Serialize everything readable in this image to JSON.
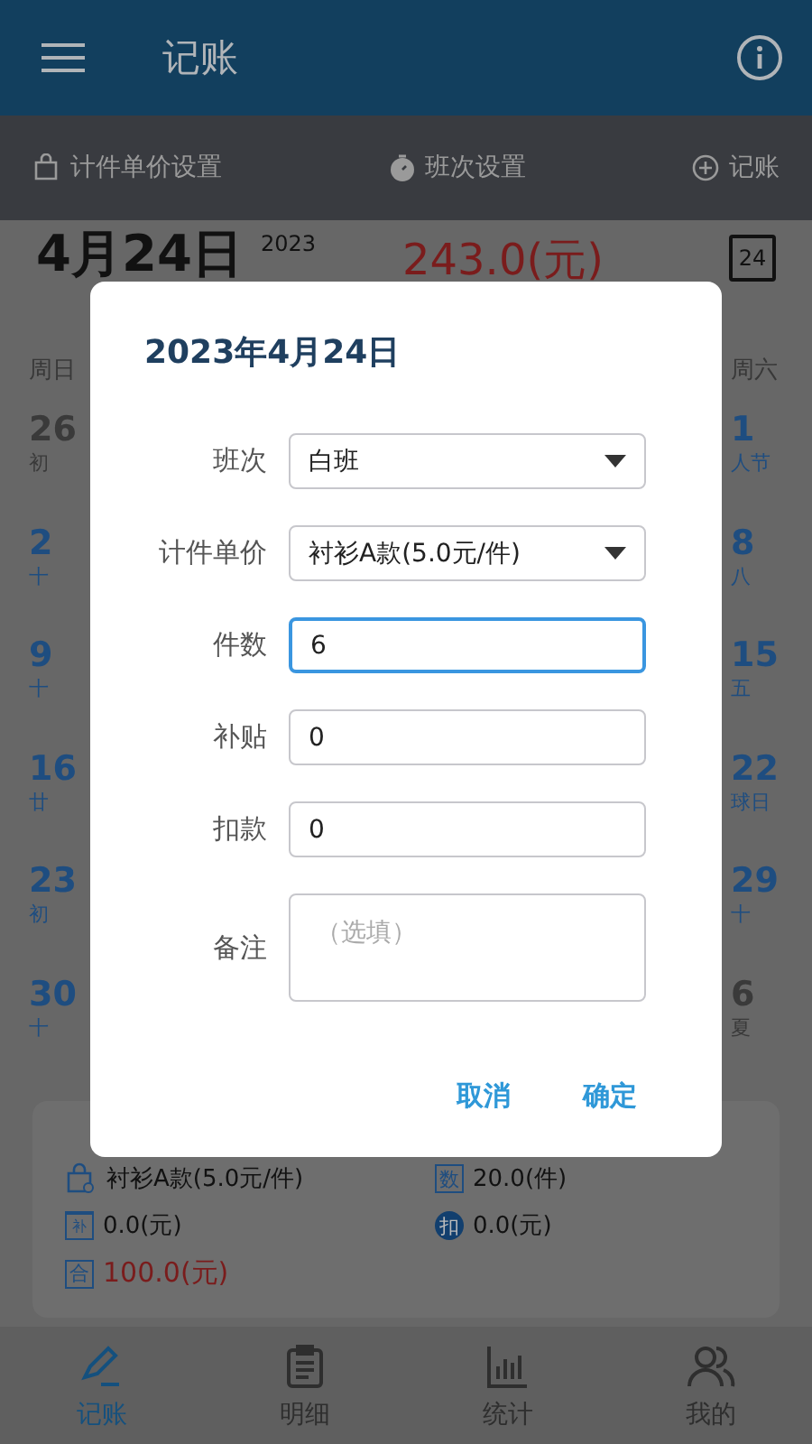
{
  "app_bar": {
    "title": "记账"
  },
  "toolbar": [
    {
      "kind": "bag",
      "label": "计件单价设置"
    },
    {
      "kind": "timer",
      "label": "班次设置"
    },
    {
      "kind": "plus",
      "label": "记账"
    }
  ],
  "date_header": {
    "date": "4月24日",
    "year": "2023",
    "total": "243.0(元)",
    "calendar_day": "24"
  },
  "calendar": {
    "columns": [
      {
        "weekday": "周日",
        "days": [
          {
            "day": "26",
            "lunar": "初",
            "in_month": false
          },
          {
            "day": "2",
            "lunar": "十",
            "in_month": true
          },
          {
            "day": "9",
            "lunar": "十",
            "in_month": true
          },
          {
            "day": "16",
            "lunar": "廿",
            "in_month": true
          },
          {
            "day": "23",
            "lunar": "初",
            "in_month": true
          },
          {
            "day": "30",
            "lunar": "十",
            "in_month": true
          }
        ]
      },
      {
        "weekday": "周六",
        "days": [
          {
            "day": "1",
            "lunar": "人节",
            "in_month": true
          },
          {
            "day": "8",
            "lunar": "八",
            "in_month": true
          },
          {
            "day": "15",
            "lunar": "五",
            "in_month": true
          },
          {
            "day": "22",
            "lunar": "球日",
            "in_month": true
          },
          {
            "day": "29",
            "lunar": "十",
            "in_month": true
          },
          {
            "day": "6",
            "lunar": "夏",
            "in_month": false
          }
        ]
      }
    ]
  },
  "day_summary": {
    "items": [
      {
        "kind": "bag",
        "text": "衬衫A款(5.0元/件)",
        "emphasis": false
      },
      {
        "kind": "square",
        "badge": "数",
        "text": "20.0(件)",
        "emphasis": false
      },
      {
        "kind": "calendar",
        "badge": "补",
        "text": "0.0(元)",
        "emphasis": false
      },
      {
        "kind": "circle",
        "badge": "扣",
        "text": "0.0(元)",
        "emphasis": false
      },
      {
        "kind": "square",
        "badge": "合",
        "text": "100.0(元)",
        "emphasis": true
      }
    ]
  },
  "tabs": [
    {
      "kind": "pencil",
      "label": "记账",
      "selected": true
    },
    {
      "kind": "clipboard",
      "label": "明细",
      "selected": false
    },
    {
      "kind": "chart",
      "label": "统计",
      "selected": false
    },
    {
      "kind": "people",
      "label": "我的",
      "selected": false
    }
  ],
  "dialog": {
    "title": "2023年4月24日",
    "fields": [
      {
        "kind": "select",
        "label": "班次",
        "value": "白班",
        "focused": false
      },
      {
        "kind": "select",
        "label": "计件单价",
        "value": "衬衫A款(5.0元/件)",
        "focused": false
      },
      {
        "kind": "input",
        "label": "件数",
        "value": "6",
        "focused": true
      },
      {
        "kind": "input",
        "label": "补贴",
        "value": "0",
        "focused": false
      },
      {
        "kind": "input",
        "label": "扣款",
        "value": "0",
        "focused": false
      },
      {
        "kind": "textarea",
        "label": "备注",
        "placeholder": "（选填）",
        "focused": false
      }
    ],
    "buttons": [
      "取消",
      "确定"
    ]
  }
}
